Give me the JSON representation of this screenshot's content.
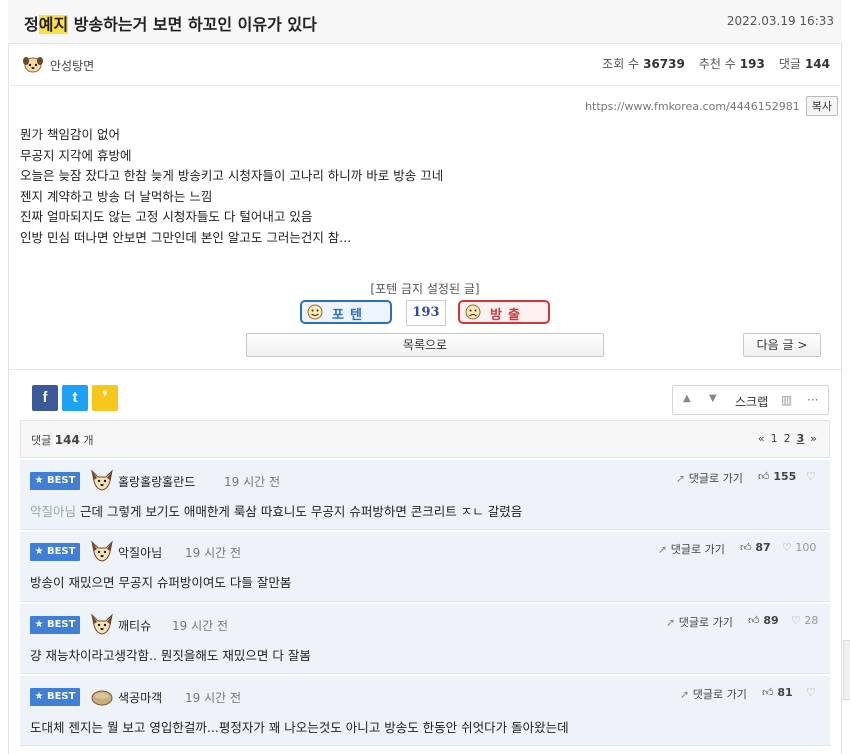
{
  "post": {
    "title_before": "정",
    "title_highlight": "예지",
    "title_after": " 방송하는거 보면 하꼬인 이유가 있다",
    "date": "2022.03.19 16:33",
    "author": "안성탕면",
    "views_label": "조회 수",
    "views": "36739",
    "recommend_label": "추천 수",
    "recommend": "193",
    "comments_label": "댓글",
    "comments": "144",
    "url": "https://www.fmkorea.com/4446152981",
    "copy_label": "복사",
    "body": [
      "뭔가 책임감이 없어",
      "무공지 지각에 휴방에",
      "오늘은 늦잠 잤다고 한참 늦게 방송키고 시청자들이 고나리 하니까 바로 방송 끄네",
      "젠지 계약하고 방송 더 날먹하는 느낌",
      "진짜 얼마되지도 않는 고정 시청자들도 다 털어내고 있음",
      "인방 민심 떠나면 안보면 그만인데 본인 알고도 그러는건지 참..."
    ]
  },
  "vote": {
    "notice": "[포텐 금지 설정된 글]",
    "potent_label": "포텐",
    "count": "193",
    "ban_label": "방출"
  },
  "nav": {
    "list_label": "목록으로",
    "next_label": "다음 글 >"
  },
  "share": {
    "facebook": "f",
    "twitter": "t",
    "kakao": "❜"
  },
  "tools": {
    "up": "▲",
    "down": "▼",
    "scrap": "스크랩",
    "stats": "▥",
    "more": "···"
  },
  "comment_bar": {
    "label": "댓글",
    "count": "144",
    "unit": "개",
    "pages": [
      "«",
      "1",
      "2",
      "3",
      "»"
    ]
  },
  "comments": [
    {
      "badge": "★ BEST",
      "author": "홀랑홀랑홀란드",
      "time": "19 시간 전",
      "reply": "댓글로 가기",
      "up": "155",
      "down": "",
      "mention": "악질아님",
      "text": "근데 그렇게 보기도 애매한게 룩삼 따효니도 무공지 슈퍼방하면 콘크리트 ㅈㄴ 갈렸음"
    },
    {
      "badge": "★ BEST",
      "author": "악질아님",
      "time": "19 시간 전",
      "reply": "댓글로 가기",
      "up": "87",
      "down": "100",
      "mention": "",
      "text": "방송이 재밌으면 무공지 슈퍼방이여도 다들 잘만봄"
    },
    {
      "badge": "★ BEST",
      "author": "깨티슈",
      "time": "19 시간 전",
      "reply": "댓글로 가기",
      "up": "89",
      "down": "28",
      "mention": "",
      "text": "걍 재능차이라고생각함.. 뭔짓을해도 재밌으면 다 잘봄"
    },
    {
      "badge": "★ BEST",
      "author": "색공마객",
      "time": "19 시간 전",
      "reply": "댓글로 가기",
      "up": "81",
      "down": "",
      "mention": "",
      "text": "도대체 젠지는 뭘 보고 영입한걸까...평정자가 꽤 나오는것도 아니고 방송도 한동안 쉬엇다가 돌아왔는데"
    }
  ]
}
